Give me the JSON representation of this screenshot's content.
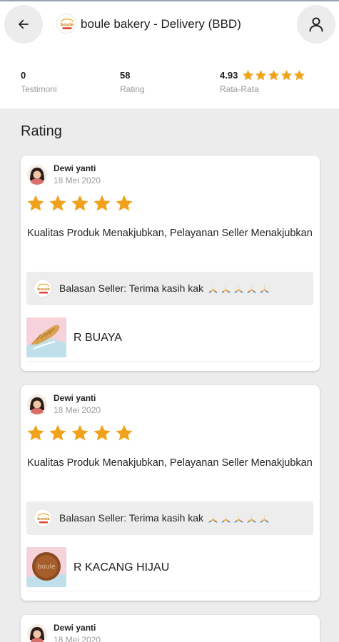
{
  "header": {
    "store_name": "boule bakery - Delivery (BBD)",
    "logo_text": "boule"
  },
  "stats": [
    {
      "value": "0",
      "label": "Testimoni"
    },
    {
      "value": "58",
      "label": "Rating"
    },
    {
      "value": "4.93",
      "label": "Rata-Rata",
      "stars": 5
    }
  ],
  "section_title": "Rating",
  "reviews": [
    {
      "reviewer": "Dewi yanti",
      "date": "18 Mei 2020",
      "stars": 5,
      "text": "Kualitas Produk Menakjubkan, Pelayanan Seller Menakjubkan",
      "reply": "Balasan Seller: Terima kasih kak",
      "reply_emoji_count": 5,
      "product": "R BUAYA"
    },
    {
      "reviewer": "Dewi yanti",
      "date": "18 Mei 2020",
      "stars": 5,
      "text": "Kualitas Produk Menakjubkan, Pelayanan Seller Menakjubkan",
      "reply": "Balasan Seller: Terima kasih kak",
      "reply_emoji_count": 5,
      "product": "R KACANG HIJAU"
    },
    {
      "reviewer": "Dewi yanti",
      "date": "18 Mei 2020"
    }
  ],
  "icons": {
    "back": "arrow-left-icon",
    "profile": "user-icon",
    "star": "star-icon",
    "pray": "folded-hands-icon"
  },
  "colors": {
    "star": "#f0a21c",
    "header_bg": "#ffffff",
    "page_bg": "#ececec",
    "reply_bg": "#ededed",
    "muted_text": "#9c9c9c"
  }
}
